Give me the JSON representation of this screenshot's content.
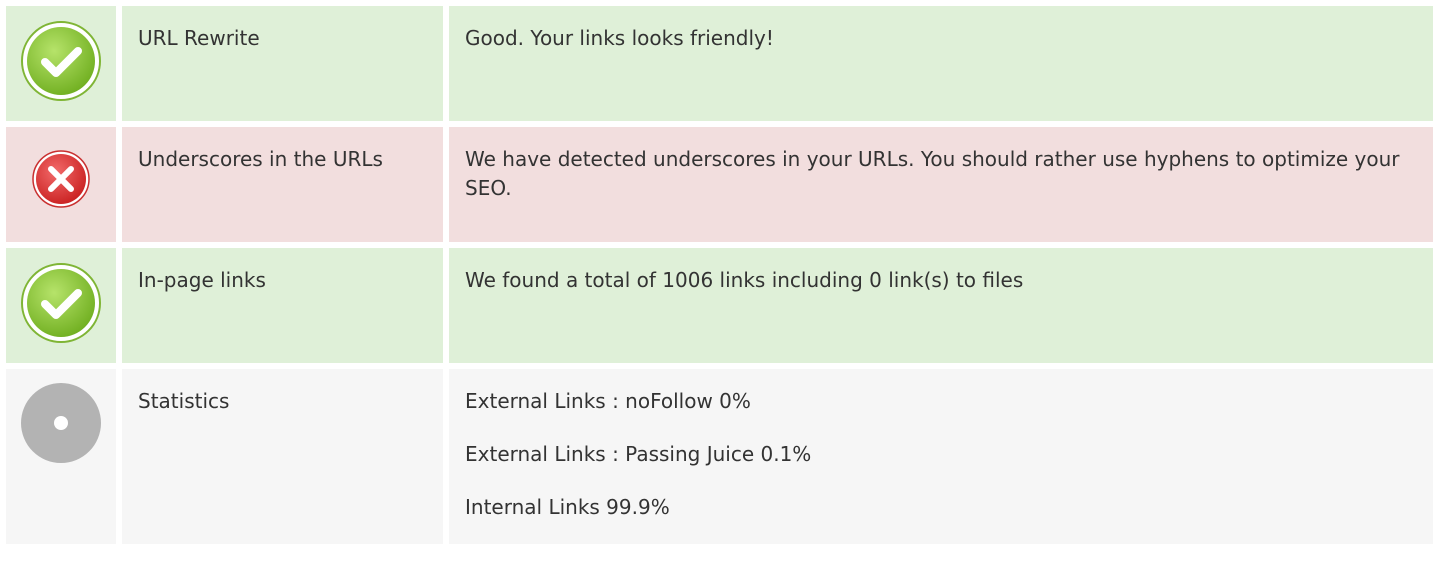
{
  "colors": {
    "good_bg": "#dff0d8",
    "bad_bg": "#f2dede",
    "info_bg": "#f6f6f6",
    "good_icon": "#8dc63f",
    "bad_icon": "#e23a3a",
    "info_icon": "#b3b3b3"
  },
  "rows": [
    {
      "status": "good",
      "icon": "check-circle-icon",
      "name": "URL Rewrite",
      "description": "Good. Your links looks friendly!"
    },
    {
      "status": "bad",
      "icon": "x-circle-icon",
      "name": "Underscores in the URLs",
      "description": "We have detected underscores in your URLs. You should rather use hyphens to optimize your SEO."
    },
    {
      "status": "good",
      "icon": "check-circle-icon",
      "name": "In-page links",
      "description": "We found a total of 1006 links including 0 link(s) to files"
    },
    {
      "status": "info",
      "icon": "neutral-circle-icon",
      "name": "Statistics",
      "stats": [
        "External Links : noFollow 0%",
        "External Links : Passing Juice 0.1%",
        "Internal Links 99.9%"
      ]
    }
  ]
}
